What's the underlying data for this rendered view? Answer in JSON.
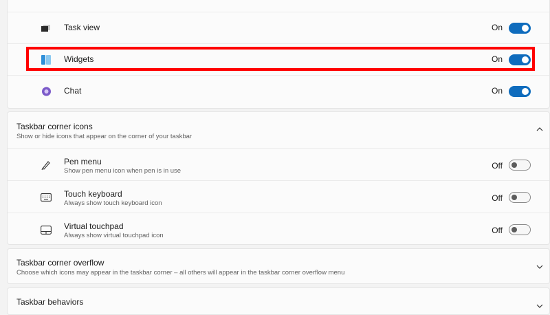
{
  "taskbar_items": {
    "task_view": {
      "label": "Task view",
      "state": "On",
      "icon": "task-view-icon"
    },
    "widgets": {
      "label": "Widgets",
      "state": "On",
      "icon": "widgets-icon"
    },
    "chat": {
      "label": "Chat",
      "state": "On",
      "icon": "chat-icon"
    }
  },
  "corner_icons": {
    "title": "Taskbar corner icons",
    "description": "Show or hide icons that appear on the corner of your taskbar",
    "pen_menu": {
      "label": "Pen menu",
      "sublabel": "Show pen menu icon when pen is in use",
      "state": "Off",
      "icon": "pen-icon"
    },
    "touch_keyboard": {
      "label": "Touch keyboard",
      "sublabel": "Always show touch keyboard icon",
      "state": "Off",
      "icon": "keyboard-icon"
    },
    "virtual_touchpad": {
      "label": "Virtual touchpad",
      "sublabel": "Always show virtual touchpad icon",
      "state": "Off",
      "icon": "touchpad-icon"
    }
  },
  "corner_overflow": {
    "title": "Taskbar corner overflow",
    "description": "Choose which icons may appear in the taskbar corner – all others will appear in the taskbar corner overflow menu"
  },
  "behaviors": {
    "title": "Taskbar behaviors"
  },
  "colors": {
    "accent": "#0f6cbd",
    "highlight": "#ff0000"
  }
}
